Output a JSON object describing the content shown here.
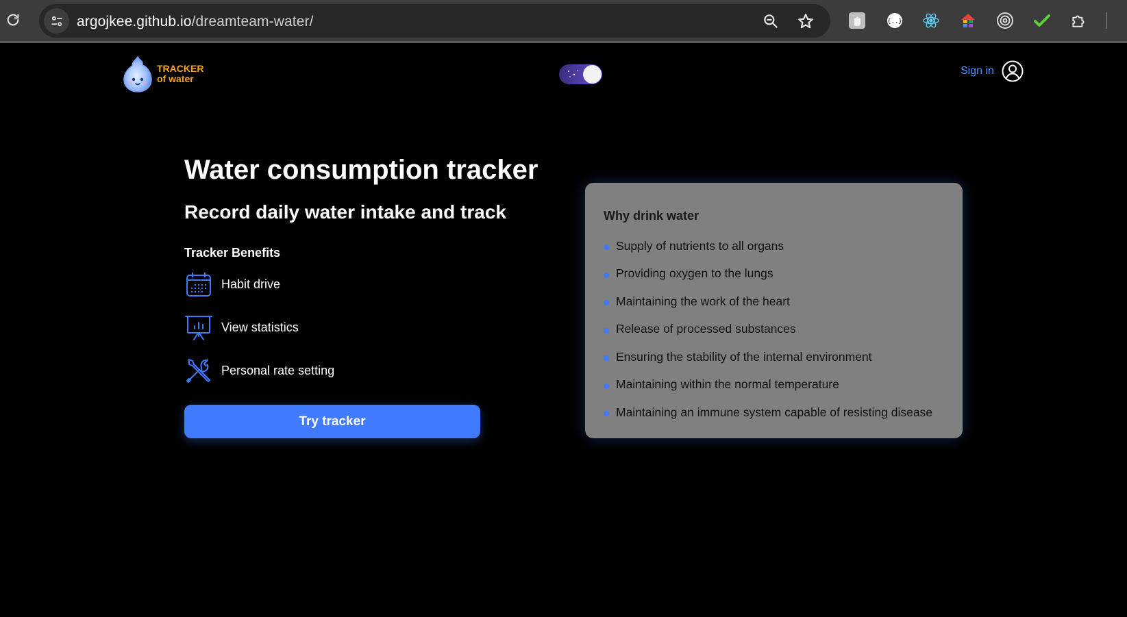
{
  "browser": {
    "url_host": "argojkee.github.io",
    "url_path": "/dreamteam-water/",
    "extensions": [
      "hand-extension-icon",
      "json-extension-icon",
      "react-devtools-icon",
      "house-extension-icon",
      "target-extension-icon",
      "check-extension-icon",
      "puzzle-extensions-icon"
    ]
  },
  "header": {
    "logo_line1": "TRACKER",
    "logo_line2": "of water",
    "signin_label": "Sign in"
  },
  "hero": {
    "title": "Water consumption tracker",
    "subtitle": "Record daily water intake and track",
    "benefits_title": "Tracker Benefits",
    "benefits": [
      {
        "label": "Habit drive",
        "icon": "calendar-icon"
      },
      {
        "label": "View statistics",
        "icon": "presentation-chart-icon"
      },
      {
        "label": "Personal rate setting",
        "icon": "tools-icon"
      }
    ],
    "cta_label": "Try tracker"
  },
  "why": {
    "title": "Why drink water",
    "items": [
      "Supply of nutrients to all organs",
      "Providing oxygen to the lungs",
      "Maintaining the work of the heart",
      "Release of processed substances",
      "Ensuring the stability of the internal environment",
      "Maintaining within the normal temperature",
      "Maintaining an immune system capable of resisting disease"
    ]
  },
  "colors": {
    "accent": "#407bff",
    "logo_text": "#f5a623",
    "card_bg": "#808080",
    "page_bg": "#000000"
  }
}
